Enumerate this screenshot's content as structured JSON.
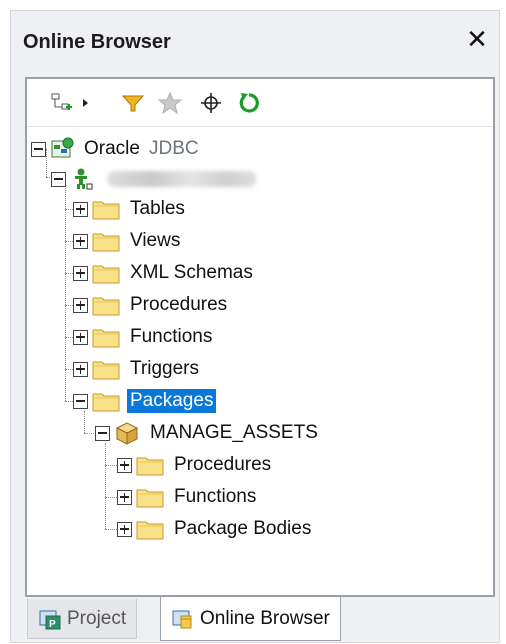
{
  "window": {
    "title": "Online Browser"
  },
  "toolbar": {
    "buttons": [
      {
        "name": "add-object-icon"
      },
      {
        "name": "filter-icon"
      },
      {
        "name": "favorite-star-icon"
      },
      {
        "name": "locate-crosshair-icon"
      },
      {
        "name": "refresh-icon"
      }
    ]
  },
  "tree": {
    "root": {
      "label": "Oracle",
      "sublabel": "JDBC"
    },
    "items": {
      "tables": "Tables",
      "views": "Views",
      "xml_schemas": "XML Schemas",
      "procedures": "Procedures",
      "functions": "Functions",
      "triggers": "Triggers",
      "packages": "Packages",
      "manage_assets": "MANAGE_ASSETS",
      "pkg_procedures": "Procedures",
      "pkg_functions": "Functions",
      "pkg_bodies": "Package Bodies"
    }
  },
  "tabs": {
    "project": "Project",
    "online_browser": "Online Browser"
  },
  "colors": {
    "selection": "#0a78d7",
    "folder": "#f3c94b",
    "refresh": "#1a9b2c",
    "filter": "#e0a020"
  }
}
